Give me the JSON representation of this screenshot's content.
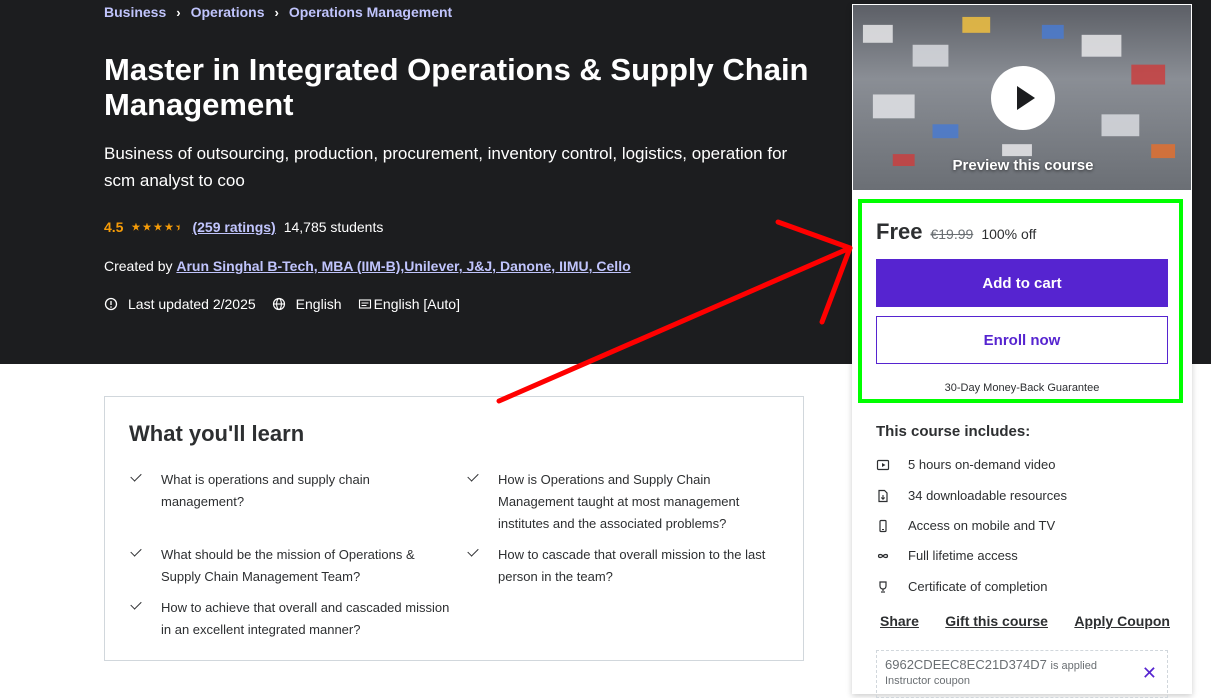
{
  "breadcrumb": [
    "Business",
    "Operations",
    "Operations Management"
  ],
  "course": {
    "title": "Master in Integrated Operations & Supply Chain Management",
    "subtitle": "Business of outsourcing, production, procurement, inventory control, logistics, operation for scm analyst to coo",
    "rating": "4.5",
    "rating_value": 4.5,
    "ratings_count": "(259 ratings)",
    "students": "14,785 students",
    "created_by_label": "Created by",
    "instructors": "Arun Singhal B-Tech, MBA (IIM-B),Unilever, J&J, Danone, IIMU, Cello",
    "last_updated": "Last updated 2/2025",
    "language": "English",
    "captions": "English [Auto]"
  },
  "learn": {
    "heading": "What you'll learn",
    "points": [
      "What is operations and supply chain management?",
      "How is Operations and Supply Chain Management taught at most management institutes and the associated problems?",
      "What should be the mission of Operations & Supply Chain Management Team?",
      "How to cascade that overall mission to the last person in the team?",
      "How to achieve that overall and cascaded mission in an excellent integrated manner?"
    ]
  },
  "sidebar": {
    "preview_label": "Preview this course",
    "price": "Free",
    "original_price": "€19.99",
    "discount": "100% off",
    "add_to_cart": "Add to cart",
    "enroll_now": "Enroll now",
    "guarantee": "30-Day Money-Back Guarantee",
    "includes_title": "This course includes:",
    "includes": [
      {
        "icon": "video-icon",
        "label": "5 hours on-demand video"
      },
      {
        "icon": "file-download-icon",
        "label": "34 downloadable resources"
      },
      {
        "icon": "mobile-icon",
        "label": "Access on mobile and TV"
      },
      {
        "icon": "infinity-icon",
        "label": "Full lifetime access"
      },
      {
        "icon": "trophy-icon",
        "label": "Certificate of completion"
      }
    ],
    "share": "Share",
    "gift": "Gift this course",
    "apply_coupon": "Apply Coupon",
    "coupon_code": "6962CDEEC8EC21D374D7",
    "coupon_applied": "is applied",
    "coupon_type": "Instructor coupon"
  },
  "colors": {
    "hero_bg": "#1c1d1f",
    "accent_purple": "#5624d0",
    "link_lilac": "#c0c4fc",
    "star": "#f69c08",
    "annotation_green": "#00ff00",
    "annotation_red": "#ff0000"
  }
}
